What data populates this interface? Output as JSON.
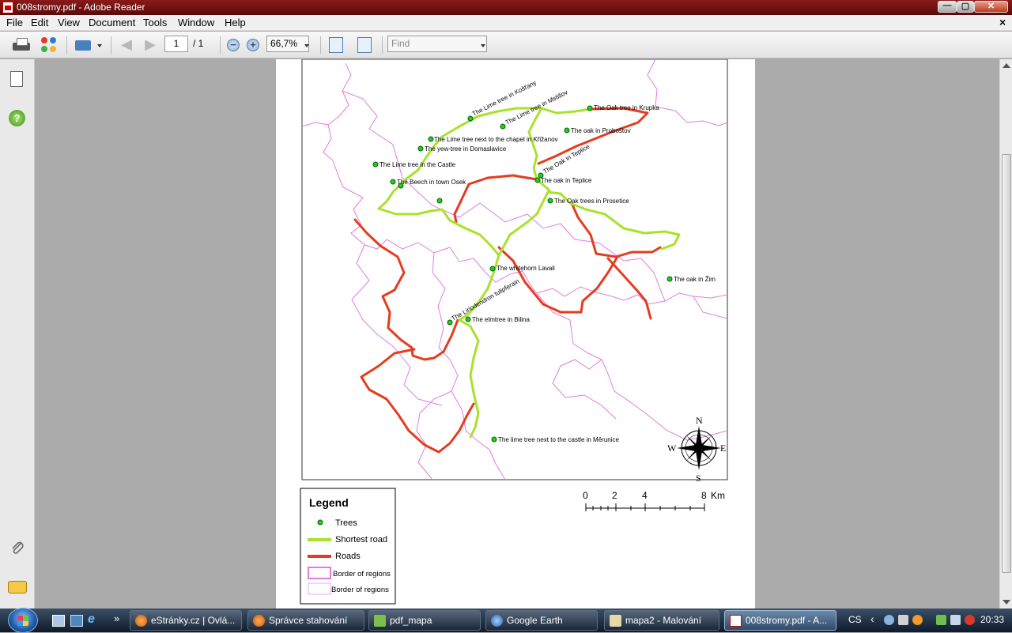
{
  "window": {
    "title": "008stromy.pdf - Adobe Reader",
    "buttons": {
      "minimize": "—",
      "maximize": "▢",
      "close": "✕"
    }
  },
  "menu": {
    "items": [
      "File",
      "Edit",
      "View",
      "Document",
      "Tools",
      "Window",
      "Help"
    ],
    "close_doc": "×"
  },
  "toolbar": {
    "page_current": "1",
    "page_total": "/ 1",
    "zoom": "66,7%",
    "find_placeholder": "Find",
    "icons": [
      "print-icon",
      "collaborate-icon",
      "email-icon",
      "previous-page-icon",
      "next-page-icon",
      "zoom-out-icon",
      "zoom-in-icon",
      "fit-width-icon",
      "fit-page-icon"
    ]
  },
  "left_panel": {
    "icons": [
      "pages-icon",
      "help-icon",
      "attachments-icon",
      "comments-icon"
    ],
    "help_glyph": "?"
  },
  "map": {
    "trees": [
      "The Lime tree in Košťany",
      "The Lime tree in Mstišov",
      "The Oak tree in Krupka",
      "The oak in Proboštov",
      "The Lime tree next to the chapel in Křižanov",
      "The yew-tree in Domaslavice",
      "The Lime tree  in the Castle",
      "The Oak in Teplice",
      "The oak in Teplice",
      "The Beech in town Osek",
      "The Oak trees in Prosetice",
      "The whitehorn Lavali",
      "The oak in Žim",
      "The Liriodendron tulipferain",
      "The elmtree in Bilina",
      "The lime tree next to the castle in Měrunice"
    ],
    "compass": {
      "n": "N",
      "s": "S",
      "e": "E",
      "w": "W"
    },
    "scale": {
      "ticks": [
        "0",
        "2",
        "4",
        "8"
      ],
      "unit": "Km"
    },
    "legend": {
      "title": "Legend",
      "items": [
        "Trees",
        "Shortest road",
        "Roads",
        "Border of regions",
        "Border of regions"
      ]
    },
    "colors": {
      "shortest_road": "#a8e22a",
      "roads": "#e43c1f",
      "tree": "#1fce1f",
      "border": "#e27be2"
    }
  },
  "taskbar": {
    "tasks": [
      "eStránky.cz | Ovlá...",
      "Správce stahování",
      "pdf_mapa",
      "Google Earth",
      "mapa2 - Malování",
      "008stromy.pdf - A..."
    ],
    "quicklaunch_more": "»",
    "tray": {
      "lang": "CS",
      "chevron": "‹",
      "time": "20:33"
    }
  }
}
